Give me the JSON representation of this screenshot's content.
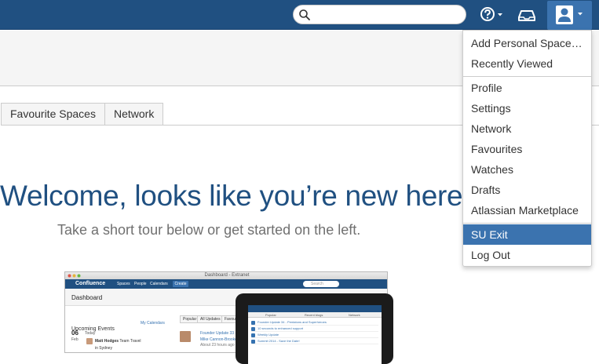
{
  "topbar": {
    "search": {
      "placeholder": "",
      "value": ""
    },
    "help_icon": "question-circle-icon",
    "notifications_icon": "inbox-tray-icon",
    "user_icon": "user-silhouette-icon",
    "colors": {
      "bar": "#205081",
      "user_button": "#3b73af"
    }
  },
  "tabs": [
    {
      "label": "Favourite Spaces"
    },
    {
      "label": "Network"
    }
  ],
  "welcome": {
    "title": "Welcome, looks like you’re new here",
    "subtitle": "Take a short tour below or get started on the left."
  },
  "preview": {
    "window_title": "Dashboard - Extranet",
    "nav": {
      "logo": "Confluence",
      "links": [
        "Spaces",
        "People",
        "Calendars"
      ],
      "create": "Create",
      "search": "Search"
    },
    "page_title": "Dashboard",
    "upcoming": {
      "heading": "Upcoming Events",
      "my_calendars": "My Calendars",
      "day": "06",
      "day_label": "Today",
      "month": "Feb",
      "event": "Matt Hodges",
      "event_detail": "Team Travel",
      "event_line2": "in Sydney"
    },
    "feed_tabs": [
      "Popular",
      "All Updates",
      "Favou"
    ],
    "feed": {
      "title": "Founder Update 33 -",
      "author": "Mike Cannon-Brookes",
      "time": "About 23 hours ago"
    },
    "tablet": {
      "tabs": [
        "Popular",
        "Recent blogs",
        "Network"
      ],
      "rows": [
        "Founder Update 34 - Pentatons and Superheroes",
        "10 seconds to enhanced support",
        "Weekly Update",
        "Summit 2014 - Save the Date!"
      ]
    }
  },
  "user_menu": {
    "groups": [
      [
        "Add Personal Space…",
        "Recently Viewed"
      ],
      [
        "Profile",
        "Settings",
        "Network",
        "Favourites",
        "Watches",
        "Drafts",
        "Atlassian Marketplace"
      ],
      [
        "SU Exit",
        "Log Out"
      ]
    ],
    "active_item": "SU Exit",
    "active_color": "#3b73af"
  }
}
